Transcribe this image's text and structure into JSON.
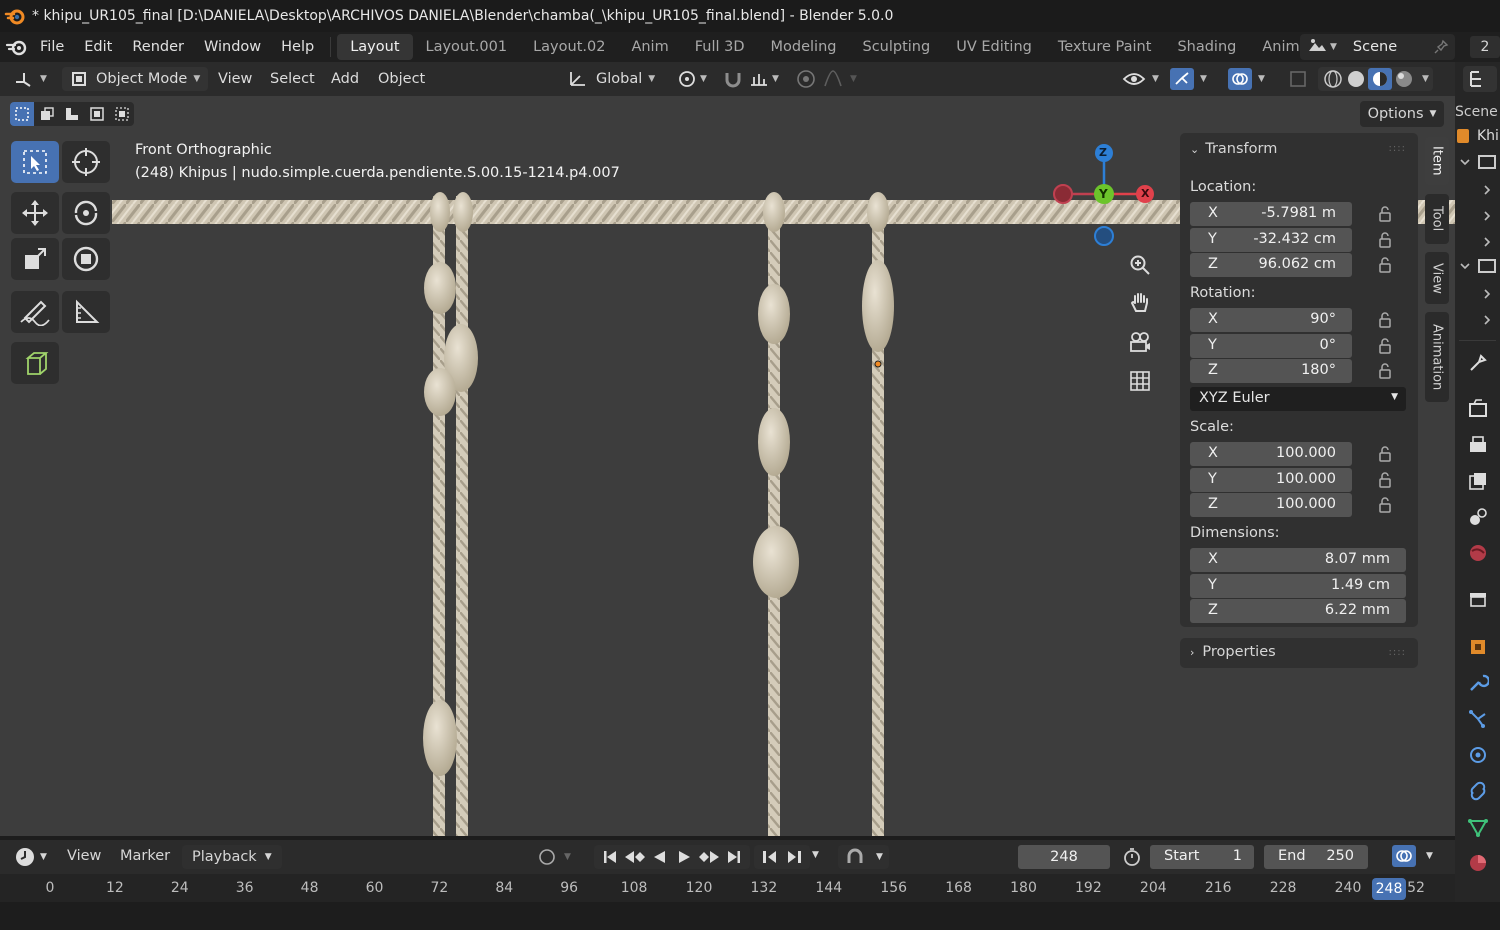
{
  "window": {
    "title": "* khipu_UR105_final [D:\\DANIELA\\Desktop\\ARCHIVOS DANIELA\\Blender\\chamba(_\\khipu_UR105_final.blend] - Blender 5.0.0"
  },
  "menu": {
    "file": "File",
    "edit": "Edit",
    "render": "Render",
    "window": "Window",
    "help": "Help"
  },
  "workspaces": [
    {
      "label": "Layout",
      "active": true
    },
    {
      "label": "Layout.001"
    },
    {
      "label": "Layout.02"
    },
    {
      "label": "Anim"
    },
    {
      "label": "Full 3D"
    },
    {
      "label": "Modeling"
    },
    {
      "label": "Sculpting"
    },
    {
      "label": "UV Editing"
    },
    {
      "label": "Texture Paint"
    },
    {
      "label": "Shading"
    },
    {
      "label": "Animati"
    }
  ],
  "scene": {
    "label": "Scene",
    "count": "2"
  },
  "viewport_header": {
    "mode": "Object Mode",
    "view": "View",
    "select": "Select",
    "add": "Add",
    "object": "Object",
    "orientation": "Global",
    "options": "Options"
  },
  "viewport": {
    "view_name": "Front Orthographic",
    "object_info": "(248) Khipus | nudo.simple.cuerda.pendiente.S.00.15-1214.p4.007",
    "gizmo": {
      "z": "Z",
      "y": "Y",
      "x": "X"
    }
  },
  "npanel": {
    "transform_header": "Transform",
    "location_label": "Location:",
    "location": [
      {
        "axis": "X",
        "value": "-5.7981 m"
      },
      {
        "axis": "Y",
        "value": "-32.432 cm"
      },
      {
        "axis": "Z",
        "value": "96.062 cm"
      }
    ],
    "rotation_label": "Rotation:",
    "rotation": [
      {
        "axis": "X",
        "value": "90°"
      },
      {
        "axis": "Y",
        "value": "0°"
      },
      {
        "axis": "Z",
        "value": "180°"
      }
    ],
    "rotation_mode": "XYZ Euler",
    "scale_label": "Scale:",
    "scale": [
      {
        "axis": "X",
        "value": "100.000"
      },
      {
        "axis": "Y",
        "value": "100.000"
      },
      {
        "axis": "Z",
        "value": "100.000"
      }
    ],
    "dimensions_label": "Dimensions:",
    "dimensions": [
      {
        "axis": "X",
        "value": "8.07 mm"
      },
      {
        "axis": "Y",
        "value": "1.49 cm"
      },
      {
        "axis": "Z",
        "value": "6.22 mm"
      }
    ],
    "properties_header": "Properties",
    "tabs": {
      "item": "Item",
      "tool": "Tool",
      "view": "View",
      "animation": "Animation"
    }
  },
  "outliner": {
    "scene_label": "Scene",
    "collection_label": "Khi"
  },
  "timeline": {
    "view": "View",
    "marker": "Marker",
    "playback": "Playback",
    "current_frame": "248",
    "start_label": "Start",
    "start_value": "1",
    "end_label": "End",
    "end_value": "250",
    "ticks": [
      "0",
      "12",
      "24",
      "36",
      "48",
      "60",
      "72",
      "84",
      "96",
      "108",
      "120",
      "132",
      "144",
      "156",
      "168",
      "180",
      "192",
      "204",
      "216",
      "228",
      "240"
    ],
    "cursor_label": "248",
    "trailing_tick": "52"
  },
  "colors": {
    "accent": "#4772b3",
    "viewport_bg": "#3d3d3d",
    "axis_x": "#e0414b",
    "axis_y": "#6cc42b",
    "axis_z": "#2d7fd6",
    "rope": "#d8cfbd"
  }
}
